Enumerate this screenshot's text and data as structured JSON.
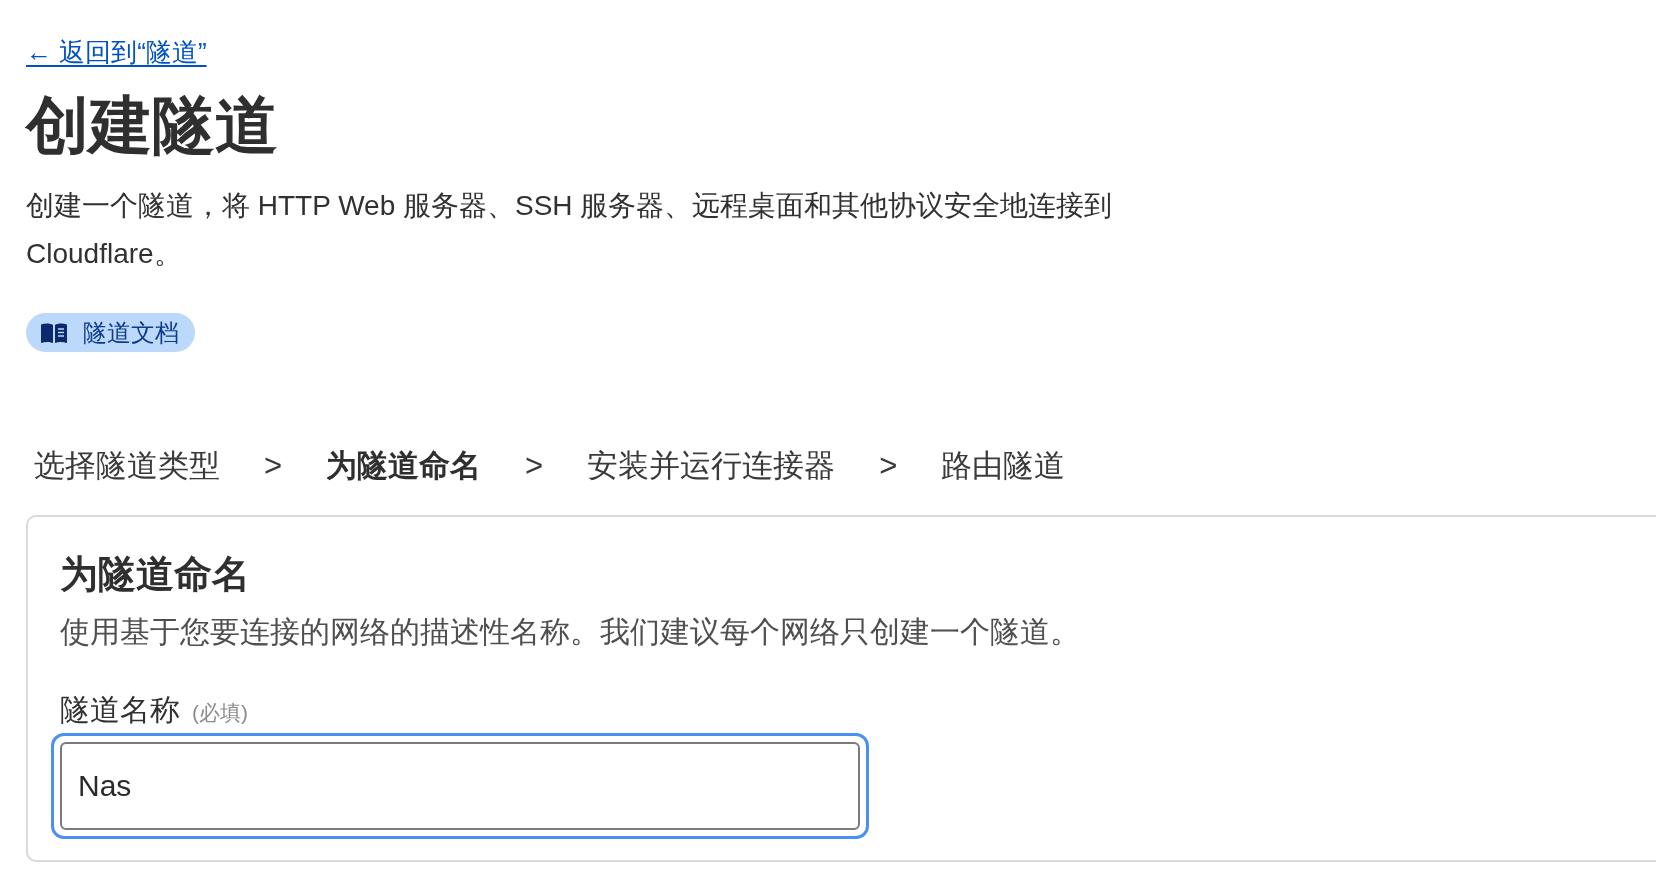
{
  "back_link": {
    "label": "← 返回到“隧道”"
  },
  "title": "创建隧道",
  "description": "创建一个隧道，将 HTTP Web 服务器、SSH 服务器、远程桌面和其他协议安全地连接到 Cloudflare。",
  "docs_button": {
    "label": "隧道文档"
  },
  "steps": [
    {
      "label": "选择隧道类型",
      "selected": false,
      "separator": ">"
    },
    {
      "label": "为隧道命名",
      "selected": true,
      "separator": ">"
    },
    {
      "label": "安装并运行连接器",
      "selected": false,
      "separator": ">"
    },
    {
      "label": "路由隧道",
      "selected": false
    }
  ],
  "card": {
    "title": "为隧道命名",
    "description": "使用基于您要连接的网络的描述性名称。我们建议每个网络只创建一个隧道。",
    "field": {
      "label": "隧道名称",
      "required_note": "(必填)",
      "value": "Nas",
      "focused": true
    }
  }
}
